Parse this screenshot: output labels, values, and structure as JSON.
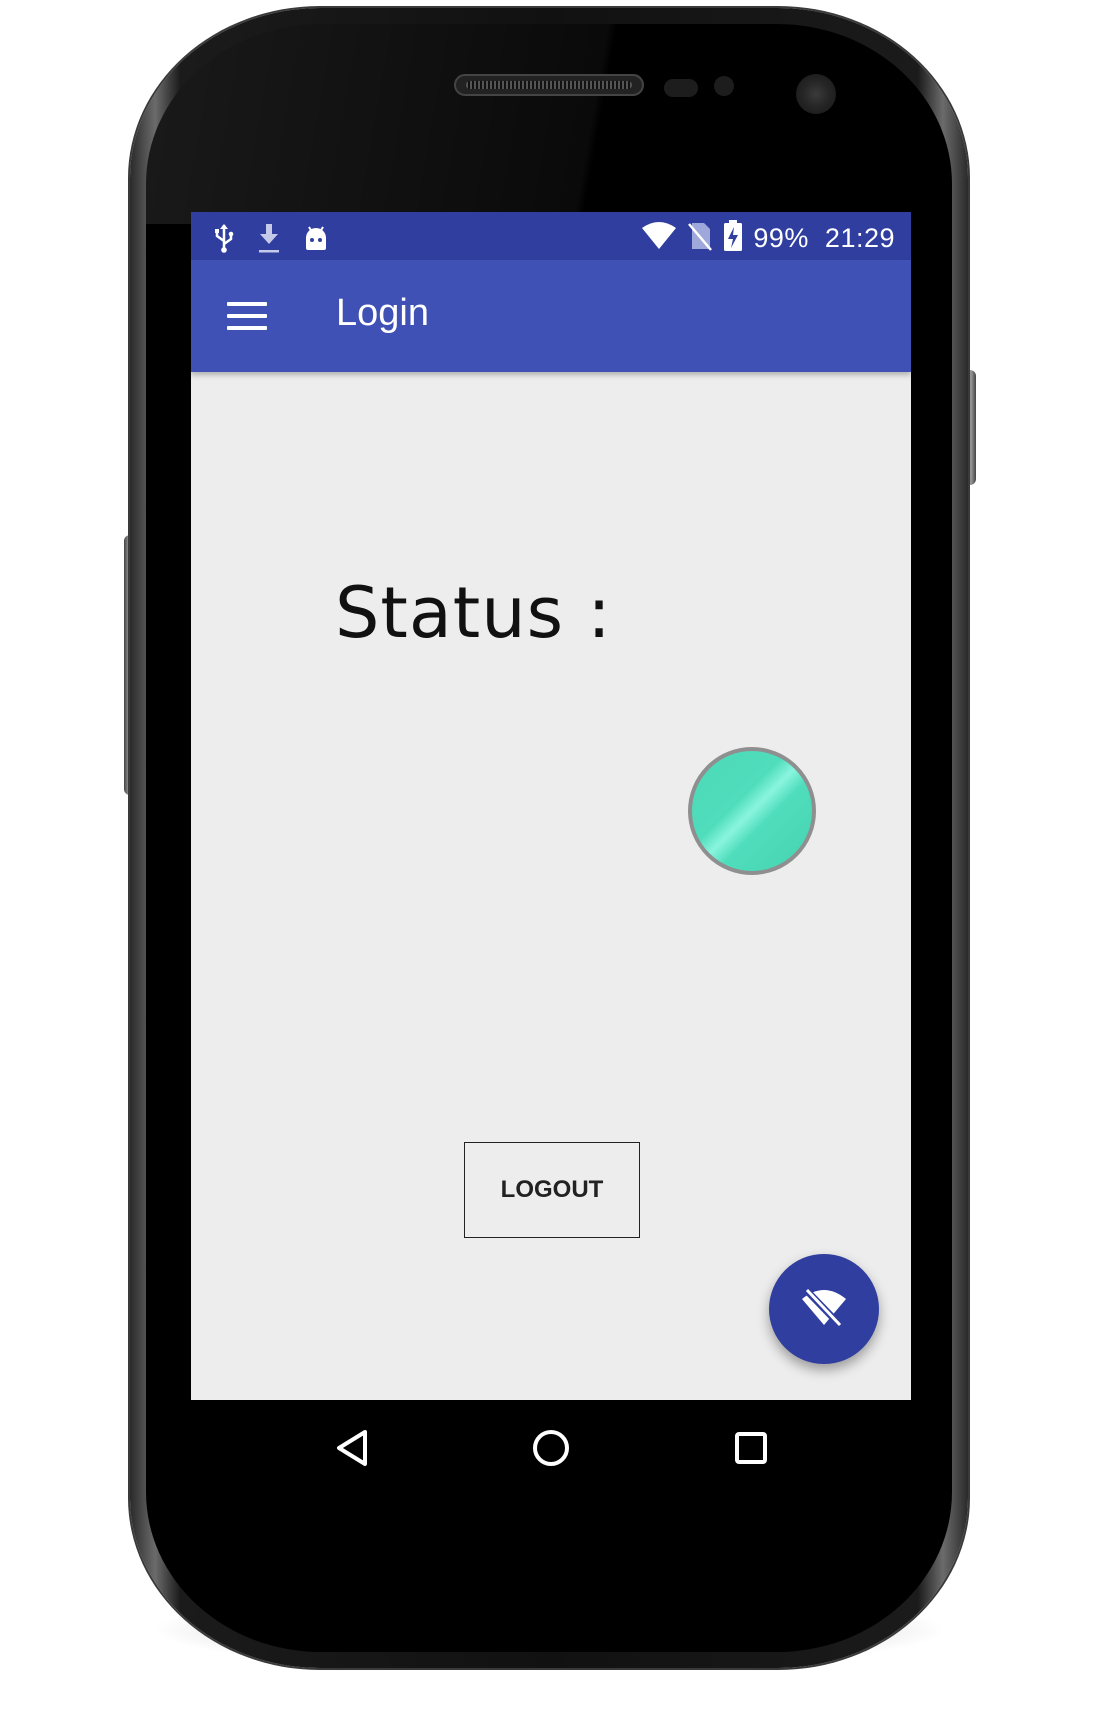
{
  "status_bar": {
    "left_icons": [
      "usb-icon",
      "download-icon",
      "android-icon"
    ],
    "battery_percent": "99%",
    "time": "21:29",
    "right_icons": [
      "wifi-icon",
      "no-sim-icon",
      "battery-charging-icon"
    ]
  },
  "app_bar": {
    "title": "Login",
    "menu_icon": "menu-icon"
  },
  "main": {
    "status_label": "Status :",
    "status_color": "#4FDDBC",
    "logout_label": "LOGOUT"
  },
  "fab": {
    "icon": "wifi-off-icon",
    "color": "#303F9F"
  },
  "nav_bar": {
    "icons": [
      "back-icon",
      "home-icon",
      "recents-icon"
    ]
  },
  "colors": {
    "primary": "#3F51B5",
    "primary_dark": "#303F9F",
    "background": "#EDEDED"
  }
}
